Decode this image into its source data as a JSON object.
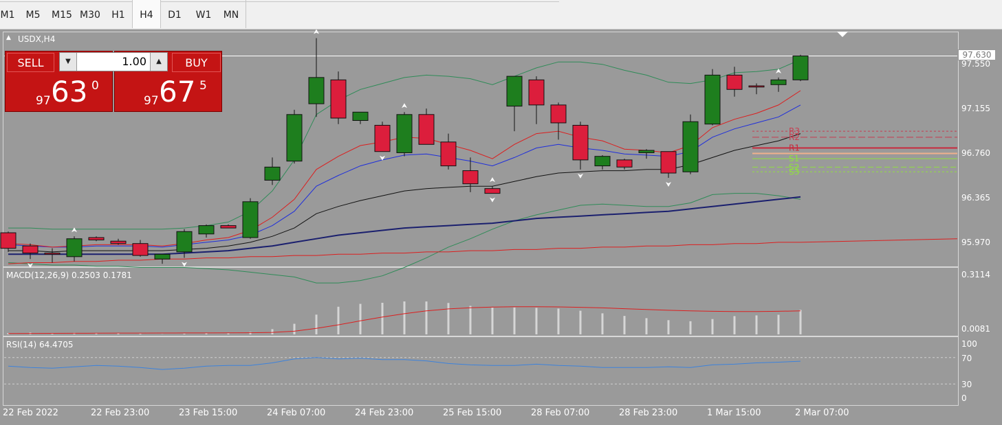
{
  "timeframes": [
    "M1",
    "M5",
    "M15",
    "M30",
    "H1",
    "H4",
    "D1",
    "W1",
    "MN"
  ],
  "active_timeframe": "H4",
  "symbol_label": "USDX,H4",
  "trade_panel": {
    "sell_label": "SELL",
    "buy_label": "BUY",
    "lot_value": "1.00",
    "sell_price": {
      "prefix": "97",
      "main": "63",
      "sup": "0"
    },
    "buy_price": {
      "prefix": "97",
      "main": "67",
      "sup": "5"
    }
  },
  "current_price": "97.630",
  "price_axis_labels": [
    "97.550",
    "97.155",
    "96.760",
    "96.365",
    "95.970"
  ],
  "macd": {
    "label": "MACD(12,26,9) 0.2503 0.1781",
    "axis_labels": [
      "0.3114",
      "0.0081"
    ]
  },
  "rsi": {
    "label": "RSI(14) 64.4705",
    "axis_labels": [
      "100",
      "70",
      "30",
      "0"
    ]
  },
  "time_labels": [
    "22 Feb 2022",
    "22 Feb 23:00",
    "23 Feb 15:00",
    "24 Feb 07:00",
    "24 Feb 23:00",
    "25 Feb 15:00",
    "28 Feb 07:00",
    "28 Feb 23:00",
    "1 Mar 15:00",
    "2 Mar 07:00"
  ],
  "pivot_labels": [
    "R3",
    "R2",
    "R1",
    "S1",
    "S2",
    "S3"
  ],
  "colors": {
    "bull": "#1e7e1e",
    "bear": "#dc1e3c",
    "panel_bg": "#9a9a9a",
    "trade_red": "#c41414",
    "macd_signal": "#dc1e1e",
    "rsi_line": "#3c82dc"
  },
  "chart_data": [
    {
      "type": "candlestick",
      "title": "USDX,H4",
      "series": [
        {
          "name": "USDX",
          "ohlc": [
            [
              96.15,
              96.16,
              95.99,
              96.02
            ],
            [
              96.04,
              96.06,
              95.93,
              95.98
            ],
            [
              95.98,
              96.02,
              95.9,
              95.97
            ],
            [
              95.95,
              96.12,
              95.91,
              96.1
            ],
            [
              96.11,
              96.12,
              96.08,
              96.09
            ],
            [
              96.08,
              96.1,
              96.05,
              96.06
            ],
            [
              96.06,
              96.09,
              95.95,
              95.96
            ],
            [
              95.93,
              95.96,
              95.89,
              95.97
            ],
            [
              95.99,
              96.18,
              95.94,
              96.16
            ],
            [
              96.14,
              96.22,
              96.11,
              96.21
            ],
            [
              96.21,
              96.22,
              96.19,
              96.19
            ],
            [
              96.11,
              96.44,
              96.1,
              96.41
            ],
            [
              96.59,
              96.78,
              96.55,
              96.7
            ],
            [
              96.75,
              97.18,
              96.73,
              97.14
            ],
            [
              97.23,
              97.78,
              97.12,
              97.45
            ],
            [
              97.43,
              97.5,
              97.06,
              97.11
            ],
            [
              97.09,
              97.16,
              97.06,
              97.16
            ],
            [
              97.05,
              97.08,
              96.83,
              96.83
            ],
            [
              96.82,
              97.16,
              96.79,
              97.14
            ],
            [
              97.14,
              97.19,
              96.93,
              96.89
            ],
            [
              96.91,
              96.98,
              96.68,
              96.71
            ],
            [
              96.67,
              96.78,
              96.49,
              96.56
            ],
            [
              96.52,
              96.54,
              96.48,
              96.48
            ],
            [
              97.21,
              97.25,
              97.0,
              97.46
            ],
            [
              97.43,
              97.46,
              97.06,
              97.22
            ],
            [
              97.22,
              97.24,
              96.93,
              97.07
            ],
            [
              97.05,
              97.08,
              96.68,
              96.76
            ],
            [
              96.71,
              96.8,
              96.68,
              96.79
            ],
            [
              96.76,
              96.77,
              96.68,
              96.7
            ],
            [
              96.82,
              96.85,
              96.77,
              96.84
            ],
            [
              96.83,
              96.83,
              96.61,
              96.65
            ],
            [
              96.66,
              97.14,
              96.64,
              97.08
            ],
            [
              97.06,
              97.52,
              97.05,
              97.47
            ],
            [
              97.47,
              97.54,
              97.29,
              97.35
            ],
            [
              97.38,
              97.4,
              97.31,
              97.37
            ],
            [
              97.39,
              97.45,
              97.33,
              97.43
            ],
            [
              97.43,
              97.64,
              97.42,
              97.63
            ]
          ]
        }
      ],
      "x_axis_labels": [
        "22 Feb 2022",
        "22 Feb 23:00",
        "23 Feb 15:00",
        "24 Feb 07:00",
        "24 Feb 23:00",
        "25 Feb 15:00",
        "28 Feb 07:00",
        "28 Feb 23:00",
        "1 Mar 15:00",
        "2 Mar 07:00"
      ],
      "ylim": [
        95.88,
        97.84
      ],
      "current_price": 97.63,
      "pivots": {
        "R3": 97.0,
        "R2": 96.95,
        "R1": 96.86,
        "S1": 96.77,
        "S2": 96.7,
        "S3": 96.66
      },
      "indicators": {
        "ma_red": [
          96.06,
          96.05,
          96.03,
          96.04,
          96.05,
          96.05,
          96.05,
          96.04,
          96.06,
          96.09,
          96.11,
          96.17,
          96.28,
          96.43,
          96.68,
          96.79,
          96.88,
          96.91,
          96.95,
          96.94,
          96.89,
          96.84,
          96.77,
          96.89,
          96.98,
          97.0,
          96.95,
          96.92,
          96.85,
          96.84,
          96.82,
          96.88,
          97.03,
          97.1,
          97.15,
          97.22,
          97.34
        ],
        "ma_blue": [
          96.05,
          96.04,
          96.03,
          96.03,
          96.04,
          96.04,
          96.04,
          96.03,
          96.05,
          96.07,
          96.09,
          96.13,
          96.21,
          96.33,
          96.54,
          96.63,
          96.71,
          96.76,
          96.8,
          96.81,
          96.78,
          96.75,
          96.71,
          96.78,
          96.86,
          96.89,
          96.86,
          96.84,
          96.81,
          96.8,
          96.79,
          96.83,
          96.95,
          97.02,
          97.07,
          97.12,
          97.22
        ],
        "ma_black": [
          96.0,
          96.0,
          95.99,
          96.0,
          96.0,
          96.0,
          96.0,
          96.0,
          96.01,
          96.02,
          96.04,
          96.07,
          96.12,
          96.19,
          96.31,
          96.37,
          96.42,
          96.46,
          96.5,
          96.52,
          96.53,
          96.54,
          96.54,
          96.58,
          96.62,
          96.65,
          96.66,
          96.67,
          96.67,
          96.68,
          96.68,
          96.72,
          96.78,
          96.84,
          96.88,
          96.92,
          96.98
        ],
        "ma_navy": [
          95.97,
          95.97,
          95.97,
          95.97,
          95.97,
          95.97,
          95.97,
          95.97,
          95.98,
          95.99,
          96.0,
          96.02,
          96.04,
          96.07,
          96.1,
          96.13,
          96.15,
          96.17,
          96.19,
          96.2,
          96.21,
          96.22,
          96.23,
          96.25,
          96.27,
          96.28,
          96.29,
          96.3,
          96.31,
          96.32,
          96.33,
          96.35,
          96.37,
          96.39,
          96.41,
          96.43,
          96.45
        ],
        "ma_red_long": [
          95.89,
          95.9,
          95.9,
          95.91,
          95.91,
          95.92,
          95.92,
          95.93,
          95.93,
          95.94,
          95.94,
          95.95,
          95.95,
          95.96,
          95.96,
          95.97,
          95.97,
          95.98,
          95.98,
          95.99,
          95.99,
          96.0,
          96.0,
          96.01,
          96.01,
          96.02,
          96.02,
          96.03,
          96.03,
          96.04,
          96.04,
          96.05,
          96.05,
          96.06,
          96.06,
          96.07,
          96.07
        ],
        "bb_upper": [
          96.19,
          96.19,
          96.18,
          96.18,
          96.18,
          96.18,
          96.18,
          96.18,
          96.19,
          96.21,
          96.24,
          96.33,
          96.5,
          96.76,
          97.14,
          97.26,
          97.35,
          97.4,
          97.45,
          97.47,
          97.46,
          97.44,
          97.39,
          97.46,
          97.53,
          97.58,
          97.58,
          97.56,
          97.51,
          97.47,
          97.41,
          97.4,
          97.43,
          97.49,
          97.5,
          97.52,
          97.6
        ],
        "bb_lower": [
          95.9,
          95.89,
          95.88,
          95.88,
          95.87,
          95.87,
          95.86,
          95.86,
          95.86,
          95.85,
          95.84,
          95.82,
          95.8,
          95.78,
          95.73,
          95.73,
          95.75,
          95.79,
          95.86,
          95.94,
          96.03,
          96.1,
          96.18,
          96.25,
          96.3,
          96.34,
          96.38,
          96.39,
          96.38,
          96.37,
          96.37,
          96.4,
          96.47,
          96.48,
          96.48,
          96.46,
          96.43
        ]
      }
    },
    {
      "type": "bar",
      "title": "MACD(12,26,9) 0.2503 0.1781",
      "series": [
        {
          "name": "MACD",
          "type": "bar",
          "values": [
            0.0148,
            0.0174,
            0.0146,
            0.0161,
            0.0154,
            0.0134,
            0.0118,
            0.009,
            0.0113,
            0.0131,
            0.0128,
            0.02,
            0.0343,
            0.0613,
            0.1071,
            0.1468,
            0.1613,
            0.1667,
            0.1734,
            0.1732,
            0.1658,
            0.1511,
            0.1423,
            0.143,
            0.1413,
            0.1374,
            0.1268,
            0.1138,
            0.1007,
            0.0896,
            0.0795,
            0.0741,
            0.085,
            0.0998,
            0.1032,
            0.1064,
            0.1311
          ]
        },
        {
          "name": "Signal",
          "type": "line",
          "values": [
            0.0125,
            0.013,
            0.0132,
            0.0136,
            0.0141,
            0.0145,
            0.0148,
            0.015,
            0.0152,
            0.0155,
            0.0158,
            0.0165,
            0.018,
            0.024,
            0.038,
            0.056,
            0.076,
            0.095,
            0.112,
            0.126,
            0.136,
            0.142,
            0.145,
            0.147,
            0.147,
            0.146,
            0.144,
            0.141,
            0.137,
            0.133,
            0.129,
            0.126,
            0.124,
            0.123,
            0.123,
            0.124,
            0.126
          ]
        }
      ],
      "axis_labels": [
        "0.3114",
        "0.0081"
      ],
      "ylim": [
        0.0081,
        0.3114
      ]
    },
    {
      "type": "line",
      "title": "RSI(14) 64.4705",
      "series": [
        {
          "name": "RSI",
          "values": [
            57,
            55,
            54,
            56,
            58,
            57,
            55,
            52,
            54,
            57,
            58,
            58,
            62,
            68,
            70,
            68,
            69,
            67,
            67,
            65,
            61,
            59,
            58,
            58,
            60,
            58,
            57,
            55,
            55,
            55,
            56,
            55,
            59,
            60,
            62,
            63,
            64.47
          ]
        }
      ],
      "ylim": [
        0,
        100
      ],
      "levels": [
        30,
        70
      ],
      "axis_labels": [
        "100",
        "70",
        "30",
        "0"
      ]
    }
  ]
}
